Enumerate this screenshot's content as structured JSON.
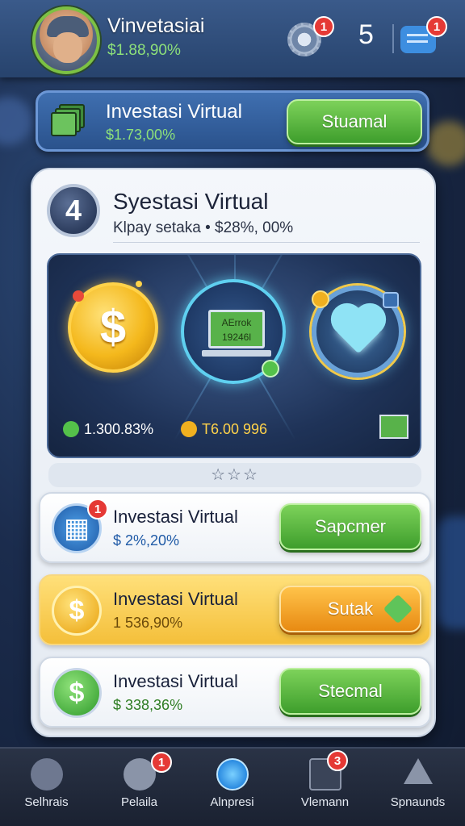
{
  "header": {
    "username": "Vinvetasiai",
    "balance": "$1.88,90%",
    "settings_badge": "1",
    "level": "5",
    "messages_badge": "1"
  },
  "promo": {
    "title": "Investasi Virtual",
    "value": "$1.73,00%",
    "button": "Stuamal"
  },
  "card": {
    "level": "4",
    "title": "Syestasi Virtual",
    "subtitle": "Klpay setaka • $28%, 00%",
    "scene": {
      "laptop_text": "AErrok 19246l",
      "stat_left": "1.300.83%",
      "stat_right": "T6.00 996",
      "coin_symbol": "$"
    },
    "stars": "☆☆☆",
    "rows": [
      {
        "title": "Investasi Virtual",
        "value": "$ 2%,20%",
        "value_color": "#1f5aa6",
        "button": "Sapcmer",
        "badge": "1"
      },
      {
        "title": "Investasi Virtual",
        "value": "1 536,90%",
        "value_color": "#6b4a0a",
        "button": "Sutak",
        "symbol": "$"
      },
      {
        "title": "Investasi Virtual",
        "value": "$ 338,36%",
        "value_color": "#2e7d22",
        "button": "Stecmal",
        "symbol": "$"
      }
    ]
  },
  "nav": [
    {
      "label": "Selhrais",
      "icon": "question-icon"
    },
    {
      "label": "Pelaila",
      "icon": "palette-icon",
      "badge": "1"
    },
    {
      "label": "Alnpresi",
      "icon": "globe-icon"
    },
    {
      "label": "Vlemann",
      "icon": "mail-icon",
      "badge": "3"
    },
    {
      "label": "Spnaunds",
      "icon": "warning-icon"
    }
  ],
  "colors": {
    "accent_green": "#4caf3a",
    "accent_orange": "#f0a020",
    "badge_red": "#e53935",
    "header_blue": "#2c4a78"
  }
}
